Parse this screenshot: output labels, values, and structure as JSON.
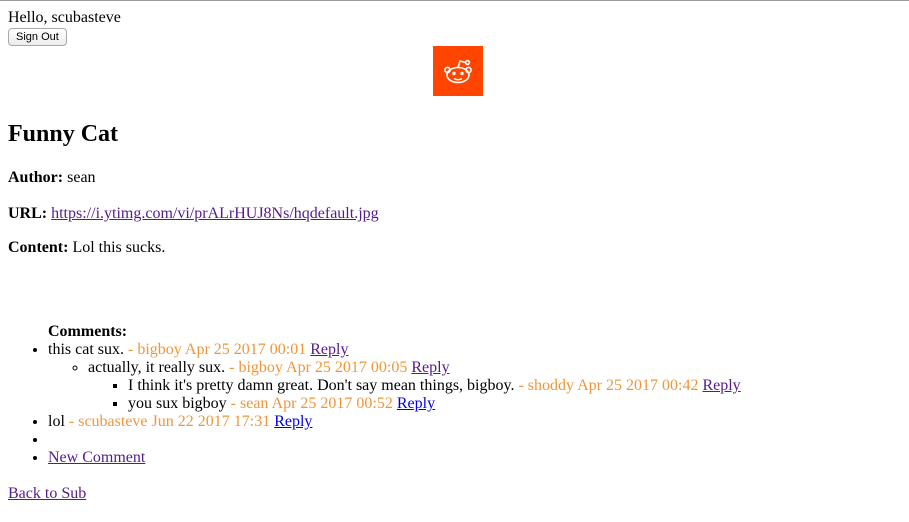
{
  "header": {
    "greeting": "Hello, scubasteve",
    "signout_label": "Sign Out"
  },
  "logo": {
    "icon": "reddit-alien-icon",
    "bg_color": "#ff4500"
  },
  "post": {
    "title": "Funny Cat",
    "author_label": "Author:",
    "author": "sean",
    "url_label": "URL:",
    "url": "https://i.ytimg.com/vi/prALrHUJ8Ns/hqdefault.jpg",
    "content_label": "Content:",
    "content": "Lol this sucks."
  },
  "comments": {
    "heading": "Comments:",
    "reply_label": "Reply",
    "new_comment_label": "New Comment",
    "items": [
      {
        "text": "this cat sux.",
        "meta": "- bigboy Apr 25 2017 00:01"
      },
      {
        "text": "actually, it really sux.",
        "meta": "- bigboy Apr 25 2017 00:05"
      },
      {
        "text": "I think it's pretty damn great. Don't say mean things, bigboy.",
        "meta": "- shoddy Apr 25 2017 00:42"
      },
      {
        "text": "you sux bigboy",
        "meta": "- sean Apr 25 2017 00:52"
      },
      {
        "text": "lol",
        "meta": "- scubasteve Jun 22 2017 17:31"
      }
    ]
  },
  "footer": {
    "back_label": "Back to Sub"
  },
  "colors": {
    "meta": "#f0963a",
    "visited_link": "#551a8b",
    "link": "#0000ee"
  }
}
